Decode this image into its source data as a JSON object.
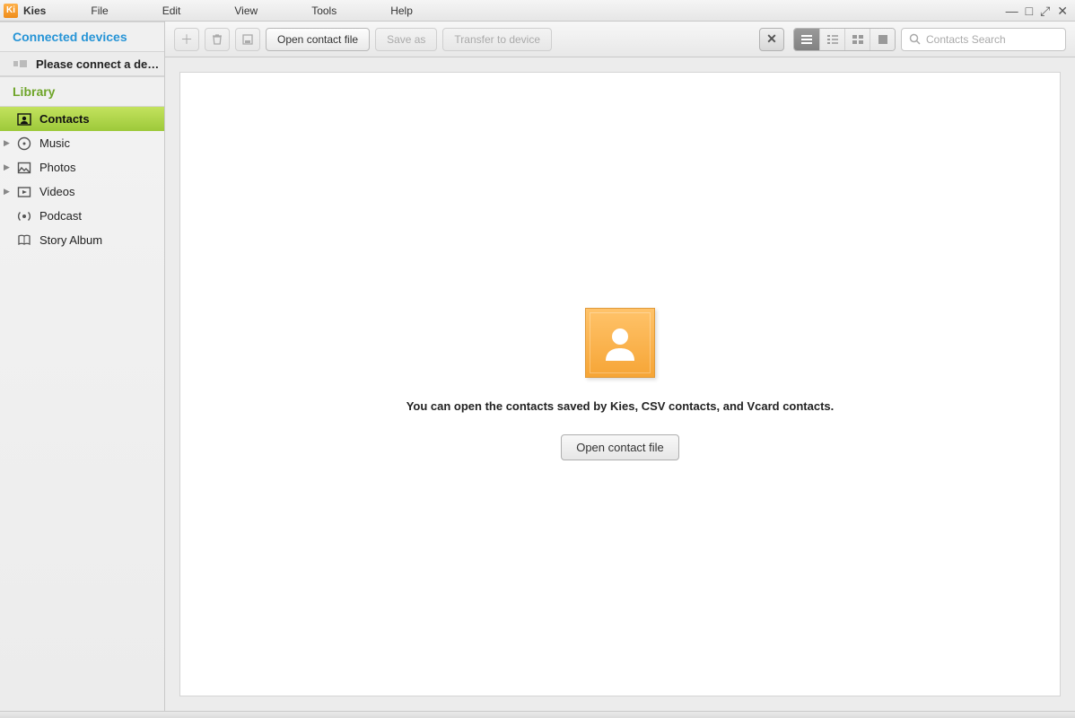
{
  "app": {
    "name": "Kies",
    "logo_letter": "Ki"
  },
  "menubar": {
    "items": [
      "File",
      "Edit",
      "View",
      "Tools",
      "Help"
    ]
  },
  "sidebar": {
    "connected_title": "Connected devices",
    "device_row": "Please connect a dev...",
    "library_title": "Library",
    "items": [
      {
        "label": "Contacts",
        "icon": "person-card-icon",
        "active": true,
        "expandable": false
      },
      {
        "label": "Music",
        "icon": "disc-icon",
        "active": false,
        "expandable": true
      },
      {
        "label": "Photos",
        "icon": "image-icon",
        "active": false,
        "expandable": true
      },
      {
        "label": "Videos",
        "icon": "film-icon",
        "active": false,
        "expandable": true
      },
      {
        "label": "Podcast",
        "icon": "broadcast-icon",
        "active": false,
        "expandable": false
      },
      {
        "label": "Story Album",
        "icon": "book-icon",
        "active": false,
        "expandable": false
      }
    ]
  },
  "toolbar": {
    "add_tooltip": "+",
    "open_label": "Open contact file",
    "save_label": "Save as",
    "transfer_label": "Transfer to device",
    "search_placeholder": "Contacts Search"
  },
  "canvas": {
    "message": "You can open the contacts saved by Kies, CSV contacts, and Vcard contacts.",
    "open_label": "Open contact file"
  }
}
